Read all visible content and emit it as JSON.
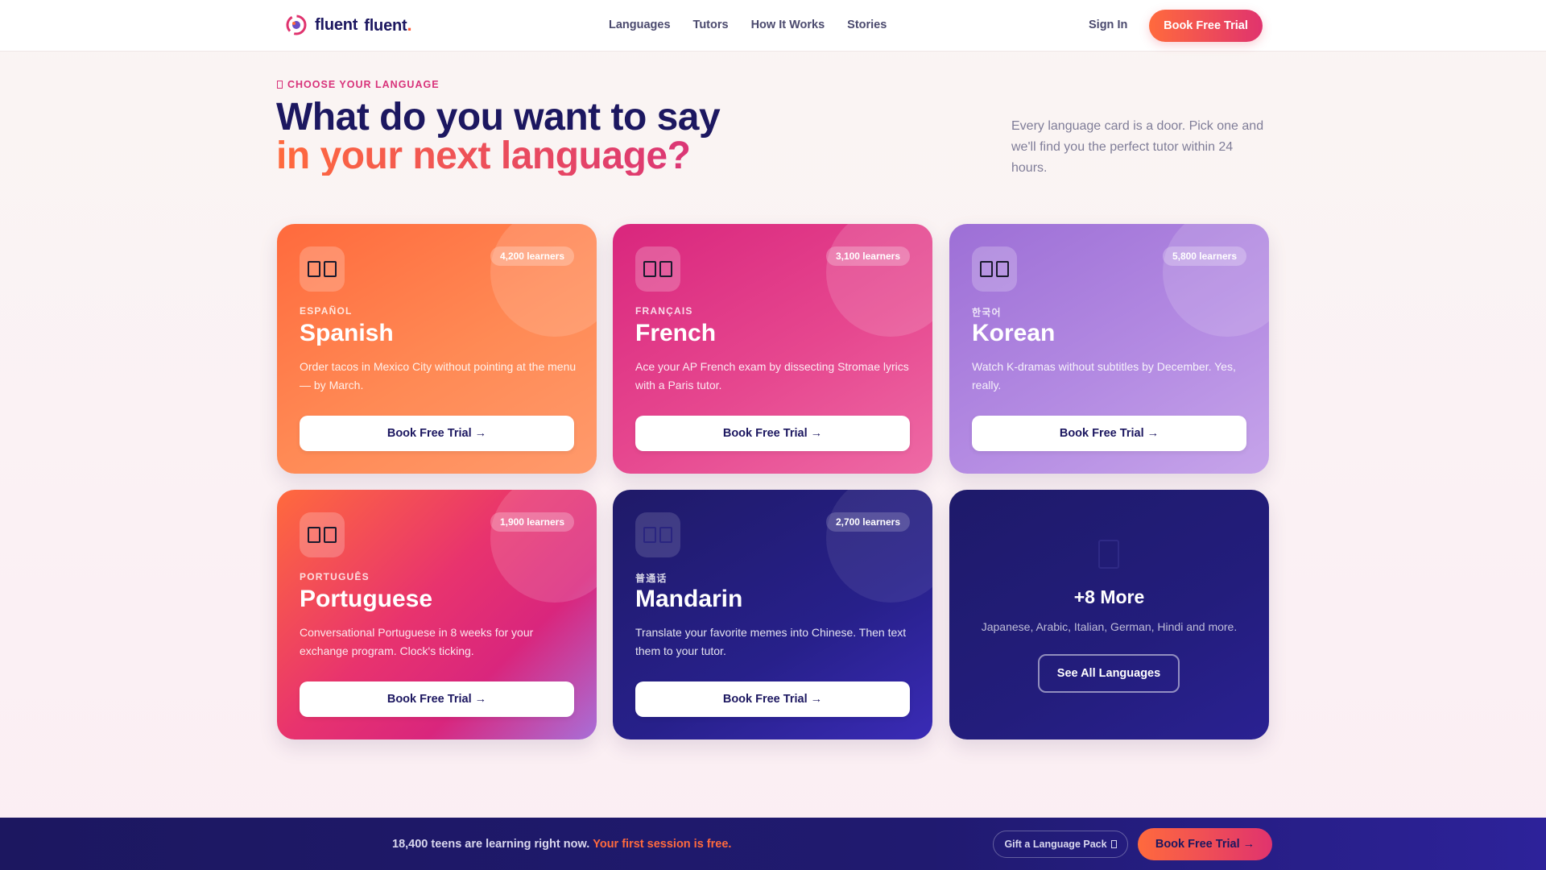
{
  "nav": {
    "brand_word_1": "fluent",
    "brand_word_2": "fluent",
    "brand_dot": ".",
    "links": [
      "Languages",
      "Tutors",
      "How It Works",
      "Stories"
    ],
    "sign_in": "Sign In",
    "cta": "Book Free Trial"
  },
  "hero": {
    "eyebrow": "CHOOSE YOUR LANGUAGE",
    "headline_line1": "What do you want to say",
    "headline_line2": "in your next language?",
    "description": "Every language card is a door. Pick one and we'll find you the perfect tutor within 24 hours."
  },
  "cards": [
    {
      "native": "ESPAÑOL",
      "name": "Spanish",
      "learners": "4,200 learners",
      "description": "Order tacos in Mexico City without pointing at the menu — by March.",
      "cta": "Book Free Trial →",
      "flag_icon": "spain-flag-icon"
    },
    {
      "native": "FRANÇAIS",
      "name": "French",
      "learners": "3,100 learners",
      "description": "Ace your AP French exam by dissecting Stromae lyrics with a Paris tutor.",
      "cta": "Book Free Trial →",
      "flag_icon": "france-flag-icon"
    },
    {
      "native": "한국어",
      "name": "Korean",
      "learners": "5,800 learners",
      "description": "Watch K-dramas without subtitles by December. Yes, really.",
      "cta": "Book Free Trial →",
      "flag_icon": "korea-flag-icon"
    },
    {
      "native": "PORTUGUÊS",
      "name": "Portuguese",
      "learners": "1,900 learners",
      "description": "Conversational Portuguese in 8 weeks for your exchange program. Clock's ticking.",
      "cta": "Book Free Trial →",
      "flag_icon": "brazil-flag-icon"
    },
    {
      "native": "普通话",
      "name": "Mandarin",
      "learners": "2,700 learners",
      "description": "Translate your favorite memes into Chinese. Then text them to your tutor.",
      "cta": "Book Free Trial →",
      "flag_icon": "china-flag-icon"
    }
  ],
  "more": {
    "title": "+8 More",
    "description": "Japanese, Arabic, Italian, German, Hindi and more.",
    "cta": "See All Languages",
    "icon": "globe-icon"
  },
  "bottom_bar": {
    "text": "18,400 teens are learning right now.",
    "highlight": "Your first session is free.",
    "gift": "Gift a Language Pack",
    "cta": "Book Free Trial →"
  },
  "colors": {
    "brand_navy": "#1c1760",
    "accent_orange": "#ff6a3d",
    "accent_pink": "#d8327a",
    "accent_purple": "#9d6fd6"
  }
}
